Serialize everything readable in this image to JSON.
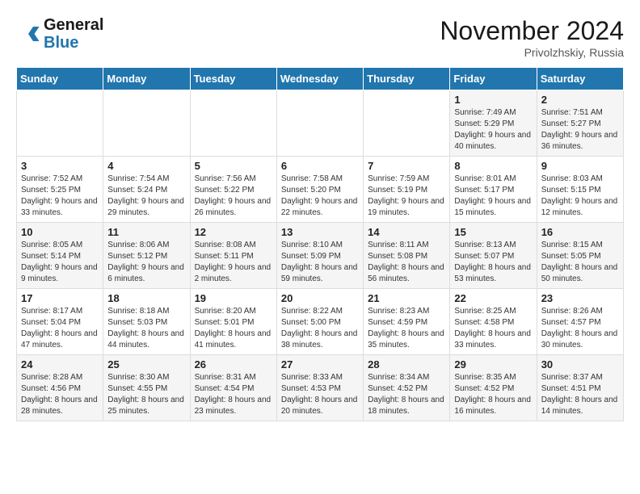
{
  "header": {
    "logo_line1": "General",
    "logo_line2": "Blue",
    "month_title": "November 2024",
    "location": "Privolzhskiy, Russia"
  },
  "weekdays": [
    "Sunday",
    "Monday",
    "Tuesday",
    "Wednesday",
    "Thursday",
    "Friday",
    "Saturday"
  ],
  "weeks": [
    [
      {
        "day": "",
        "info": ""
      },
      {
        "day": "",
        "info": ""
      },
      {
        "day": "",
        "info": ""
      },
      {
        "day": "",
        "info": ""
      },
      {
        "day": "",
        "info": ""
      },
      {
        "day": "1",
        "info": "Sunrise: 7:49 AM\nSunset: 5:29 PM\nDaylight: 9 hours and 40 minutes."
      },
      {
        "day": "2",
        "info": "Sunrise: 7:51 AM\nSunset: 5:27 PM\nDaylight: 9 hours and 36 minutes."
      }
    ],
    [
      {
        "day": "3",
        "info": "Sunrise: 7:52 AM\nSunset: 5:25 PM\nDaylight: 9 hours and 33 minutes."
      },
      {
        "day": "4",
        "info": "Sunrise: 7:54 AM\nSunset: 5:24 PM\nDaylight: 9 hours and 29 minutes."
      },
      {
        "day": "5",
        "info": "Sunrise: 7:56 AM\nSunset: 5:22 PM\nDaylight: 9 hours and 26 minutes."
      },
      {
        "day": "6",
        "info": "Sunrise: 7:58 AM\nSunset: 5:20 PM\nDaylight: 9 hours and 22 minutes."
      },
      {
        "day": "7",
        "info": "Sunrise: 7:59 AM\nSunset: 5:19 PM\nDaylight: 9 hours and 19 minutes."
      },
      {
        "day": "8",
        "info": "Sunrise: 8:01 AM\nSunset: 5:17 PM\nDaylight: 9 hours and 15 minutes."
      },
      {
        "day": "9",
        "info": "Sunrise: 8:03 AM\nSunset: 5:15 PM\nDaylight: 9 hours and 12 minutes."
      }
    ],
    [
      {
        "day": "10",
        "info": "Sunrise: 8:05 AM\nSunset: 5:14 PM\nDaylight: 9 hours and 9 minutes."
      },
      {
        "day": "11",
        "info": "Sunrise: 8:06 AM\nSunset: 5:12 PM\nDaylight: 9 hours and 6 minutes."
      },
      {
        "day": "12",
        "info": "Sunrise: 8:08 AM\nSunset: 5:11 PM\nDaylight: 9 hours and 2 minutes."
      },
      {
        "day": "13",
        "info": "Sunrise: 8:10 AM\nSunset: 5:09 PM\nDaylight: 8 hours and 59 minutes."
      },
      {
        "day": "14",
        "info": "Sunrise: 8:11 AM\nSunset: 5:08 PM\nDaylight: 8 hours and 56 minutes."
      },
      {
        "day": "15",
        "info": "Sunrise: 8:13 AM\nSunset: 5:07 PM\nDaylight: 8 hours and 53 minutes."
      },
      {
        "day": "16",
        "info": "Sunrise: 8:15 AM\nSunset: 5:05 PM\nDaylight: 8 hours and 50 minutes."
      }
    ],
    [
      {
        "day": "17",
        "info": "Sunrise: 8:17 AM\nSunset: 5:04 PM\nDaylight: 8 hours and 47 minutes."
      },
      {
        "day": "18",
        "info": "Sunrise: 8:18 AM\nSunset: 5:03 PM\nDaylight: 8 hours and 44 minutes."
      },
      {
        "day": "19",
        "info": "Sunrise: 8:20 AM\nSunset: 5:01 PM\nDaylight: 8 hours and 41 minutes."
      },
      {
        "day": "20",
        "info": "Sunrise: 8:22 AM\nSunset: 5:00 PM\nDaylight: 8 hours and 38 minutes."
      },
      {
        "day": "21",
        "info": "Sunrise: 8:23 AM\nSunset: 4:59 PM\nDaylight: 8 hours and 35 minutes."
      },
      {
        "day": "22",
        "info": "Sunrise: 8:25 AM\nSunset: 4:58 PM\nDaylight: 8 hours and 33 minutes."
      },
      {
        "day": "23",
        "info": "Sunrise: 8:26 AM\nSunset: 4:57 PM\nDaylight: 8 hours and 30 minutes."
      }
    ],
    [
      {
        "day": "24",
        "info": "Sunrise: 8:28 AM\nSunset: 4:56 PM\nDaylight: 8 hours and 28 minutes."
      },
      {
        "day": "25",
        "info": "Sunrise: 8:30 AM\nSunset: 4:55 PM\nDaylight: 8 hours and 25 minutes."
      },
      {
        "day": "26",
        "info": "Sunrise: 8:31 AM\nSunset: 4:54 PM\nDaylight: 8 hours and 23 minutes."
      },
      {
        "day": "27",
        "info": "Sunrise: 8:33 AM\nSunset: 4:53 PM\nDaylight: 8 hours and 20 minutes."
      },
      {
        "day": "28",
        "info": "Sunrise: 8:34 AM\nSunset: 4:52 PM\nDaylight: 8 hours and 18 minutes."
      },
      {
        "day": "29",
        "info": "Sunrise: 8:35 AM\nSunset: 4:52 PM\nDaylight: 8 hours and 16 minutes."
      },
      {
        "day": "30",
        "info": "Sunrise: 8:37 AM\nSunset: 4:51 PM\nDaylight: 8 hours and 14 minutes."
      }
    ]
  ]
}
